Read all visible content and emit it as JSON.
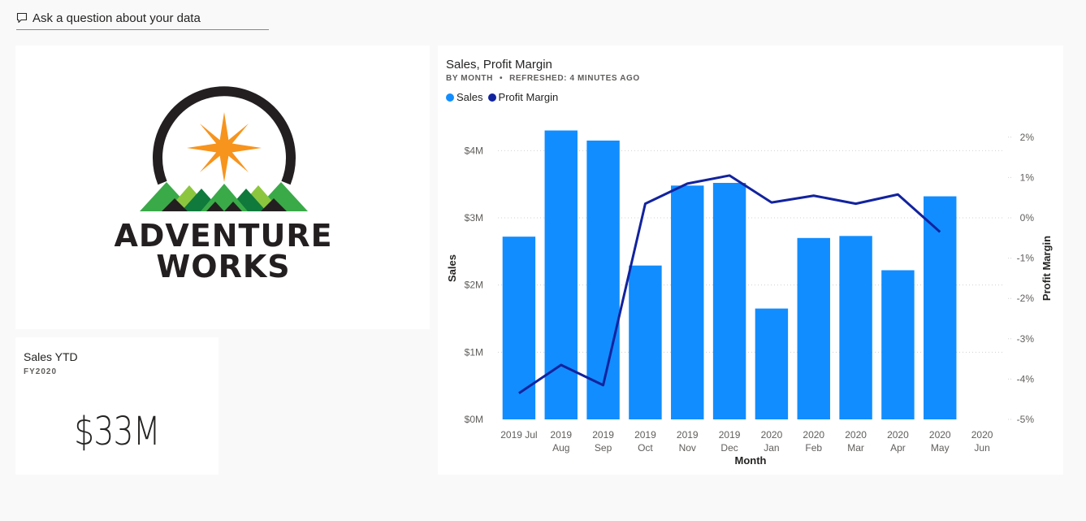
{
  "qa": {
    "label": "Ask a question about your data"
  },
  "logo": {
    "line1": "ADVENTURE",
    "line2": "WORKS"
  },
  "kpi": {
    "title": "Sales YTD",
    "subtitle": "FY2020",
    "value": "$33M"
  },
  "chart": {
    "title": "Sales, Profit Margin",
    "subtitle_by": "BY MONTH",
    "subtitle_refresh": "REFRESHED: 4 MINUTES AGO",
    "subtitle_sep": "•"
  },
  "chart_data": {
    "type": "bar",
    "xlabel": "Month",
    "ylabel": "Sales",
    "y2label": "Profit Margin",
    "categories": [
      [
        "2019 Jul"
      ],
      [
        "2019",
        "Aug"
      ],
      [
        "2019",
        "Sep"
      ],
      [
        "2019",
        "Oct"
      ],
      [
        "2019",
        "Nov"
      ],
      [
        "2019",
        "Dec"
      ],
      [
        "2020",
        "Jan"
      ],
      [
        "2020",
        "Feb"
      ],
      [
        "2020",
        "Mar"
      ],
      [
        "2020",
        "Apr"
      ],
      [
        "2020",
        "May"
      ],
      [
        "2020",
        "Jun"
      ]
    ],
    "ylim": [
      0,
      4500000
    ],
    "y2lim": [
      -5,
      2.5
    ],
    "yticks": [
      {
        "v": 0,
        "label": "$0M"
      },
      {
        "v": 1000000,
        "label": "$1M"
      },
      {
        "v": 2000000,
        "label": "$2M"
      },
      {
        "v": 3000000,
        "label": "$3M"
      },
      {
        "v": 4000000,
        "label": "$4M"
      }
    ],
    "y2ticks": [
      {
        "v": 2,
        "label": "2%"
      },
      {
        "v": 1,
        "label": "1%"
      },
      {
        "v": 0,
        "label": "0%"
      },
      {
        "v": -1,
        "label": "-1%"
      },
      {
        "v": -2,
        "label": "-2%"
      },
      {
        "v": -3,
        "label": "-3%"
      },
      {
        "v": -4,
        "label": "-4%"
      },
      {
        "v": -5,
        "label": "-5%"
      }
    ],
    "series": [
      {
        "name": "Sales",
        "kind": "bar",
        "color": "#118DFF",
        "values": [
          2720000,
          4300000,
          4150000,
          2290000,
          3480000,
          3520000,
          1650000,
          2700000,
          2730000,
          2220000,
          3320000,
          null
        ]
      },
      {
        "name": "Profit Margin",
        "kind": "line",
        "color": "#12239E",
        "values": [
          -4.35,
          -3.65,
          -4.15,
          0.35,
          0.85,
          1.05,
          0.38,
          0.55,
          0.35,
          0.58,
          -0.35,
          null
        ]
      }
    ],
    "legend_position": "top-left",
    "grid": true
  }
}
